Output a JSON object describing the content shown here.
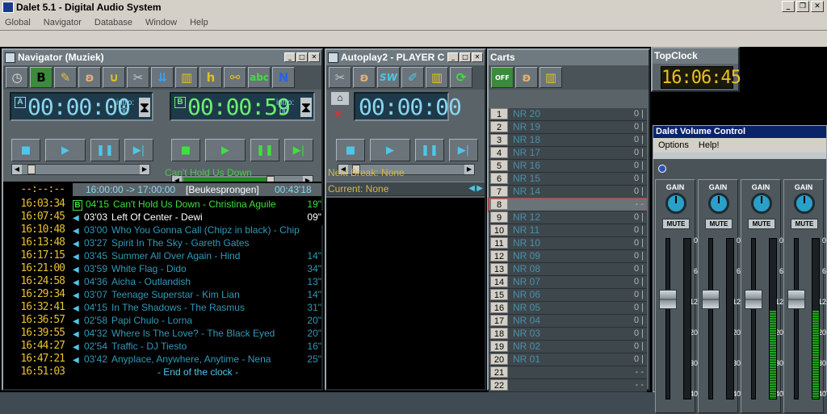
{
  "app": {
    "title": "Dalet 5.1 - Digital Audio System"
  },
  "menu": [
    "Global",
    "Navigator",
    "Database",
    "Window",
    "Help"
  ],
  "navigator": {
    "title": "Navigator (Muziek)",
    "toolbar_letters": {
      "b": "B",
      "h": "h",
      "abc": "abc",
      "n": "N"
    },
    "player_a": {
      "tag": "A",
      "time": "00:00:00",
      "intro_label": "intro:",
      "intro_value": "00"
    },
    "player_b": {
      "tag": "B",
      "time": "00:00:59",
      "intro_label": "intro:",
      "intro_value": "00",
      "progress": 0.75
    },
    "player_a_progress": 0.05,
    "now_playing": "Can't Hold Us Down",
    "clock_header": {
      "range": "16:00:00 -> 17:00:00",
      "name": "[Beukesprongen]",
      "length": "00:43'18"
    },
    "leading_time": "--:--:--",
    "playlist": [
      {
        "time": "16:03:34",
        "dur": "04'15",
        "title": "Can't Hold Us Down - Christina Aguile",
        "intro": "19\"",
        "state": "playing",
        "marker": "B"
      },
      {
        "time": "16:07:45",
        "dur": "03'03",
        "title": "Left Of Center - Dewi",
        "intro": "09\"",
        "state": "next",
        "marker": ""
      },
      {
        "time": "16:10:48",
        "dur": "03'00",
        "title": "Who You Gonna Call (Chipz in black) - Chip",
        "intro": "",
        "state": "",
        "marker": ""
      },
      {
        "time": "16:13:48",
        "dur": "03'27",
        "title": "Spirit In The Sky - Gareth Gates",
        "intro": "",
        "state": "",
        "marker": ""
      },
      {
        "time": "16:17:15",
        "dur": "03'45",
        "title": "Summer All Over Again - Hind",
        "intro": "14\"",
        "state": "",
        "marker": ""
      },
      {
        "time": "16:21:00",
        "dur": "03'59",
        "title": "White Flag - Dido",
        "intro": "34\"",
        "state": "",
        "marker": ""
      },
      {
        "time": "16:24:58",
        "dur": "04'36",
        "title": "Aicha - Outlandish",
        "intro": "13\"",
        "state": "",
        "marker": ""
      },
      {
        "time": "16:29:34",
        "dur": "03'07",
        "title": "Teenage Superstar - Kim Lian",
        "intro": "14\"",
        "state": "",
        "marker": ""
      },
      {
        "time": "16:32:41",
        "dur": "04'15",
        "title": "In The Shadows - The Rasmus",
        "intro": "31\"",
        "state": "",
        "marker": ""
      },
      {
        "time": "16:36:57",
        "dur": "02'58",
        "title": "Papi Chulo - Lorna",
        "intro": "20\"",
        "state": "",
        "marker": ""
      },
      {
        "time": "16:39:55",
        "dur": "04'32",
        "title": "Where Is The Love? - The Black Eyed",
        "intro": "20\"",
        "state": "",
        "marker": ""
      },
      {
        "time": "16:44:27",
        "dur": "02'54",
        "title": "Traffic - DJ Tiesto",
        "intro": "16\"",
        "state": "",
        "marker": ""
      },
      {
        "time": "16:47:21",
        "dur": "03'42",
        "title": "Anyplace, Anywhere, Anytime - Nena",
        "intro": "25\"",
        "state": "",
        "marker": ""
      },
      {
        "time": "16:51:03",
        "dur": "",
        "title": "- End of the clock -",
        "intro": "",
        "state": "end",
        "marker": ""
      }
    ]
  },
  "autoplay": {
    "title": "Autoplay2 - PLAYER C",
    "toolbar_letters": {
      "sw": "SW"
    },
    "time": "00:00:00",
    "progress": 0.04,
    "next_break": "Next Break: None",
    "current": "Current: None"
  },
  "carts": {
    "title": "Carts",
    "toolbar_label": "OFF",
    "items": [
      {
        "num": "1",
        "name": "NR 20",
        "count": "0 |"
      },
      {
        "num": "2",
        "name": "NR 19",
        "count": "0 |"
      },
      {
        "num": "3",
        "name": "NR 18",
        "count": "0 |"
      },
      {
        "num": "4",
        "name": "NR 17",
        "count": "0 |"
      },
      {
        "num": "5",
        "name": "NR 16",
        "count": "0 |"
      },
      {
        "num": "6",
        "name": "NR 15",
        "count": "0 |"
      },
      {
        "num": "7",
        "name": "NR 14",
        "count": "0 |"
      },
      {
        "num": "8",
        "name": "",
        "count": "- -"
      },
      {
        "num": "9",
        "name": "NR 12",
        "count": "0 |"
      },
      {
        "num": "10",
        "name": "NR 11",
        "count": "0 |"
      },
      {
        "num": "11",
        "name": "NR 10",
        "count": "0 |"
      },
      {
        "num": "12",
        "name": "NR 09",
        "count": "0 |"
      },
      {
        "num": "13",
        "name": "NR 08",
        "count": "0 |"
      },
      {
        "num": "14",
        "name": "NR 07",
        "count": "0 |"
      },
      {
        "num": "15",
        "name": "NR 06",
        "count": "0 |"
      },
      {
        "num": "16",
        "name": "NR 05",
        "count": "0 |"
      },
      {
        "num": "17",
        "name": "NR 04",
        "count": "0 |"
      },
      {
        "num": "18",
        "name": "NR 03",
        "count": "0 |"
      },
      {
        "num": "19",
        "name": "NR 02",
        "count": "0 |"
      },
      {
        "num": "20",
        "name": "NR 01",
        "count": "0 |"
      },
      {
        "num": "21",
        "name": "",
        "count": "- -"
      },
      {
        "num": "22",
        "name": "",
        "count": "- -"
      }
    ],
    "selected_index": 7
  },
  "topclock": {
    "title": "TopClock",
    "time": "16:06:45"
  },
  "volume": {
    "title": "Dalet Volume Control",
    "menu": [
      "Options",
      "Help!"
    ],
    "scale": [
      "0",
      "6",
      "12",
      "20",
      "30",
      "40"
    ],
    "channels": [
      {
        "gain": "GAIN",
        "mute": "MUTE",
        "fader": 0.62,
        "meter": 0.0
      },
      {
        "gain": "GAIN",
        "mute": "MUTE",
        "fader": 0.62,
        "meter": 0.0
      },
      {
        "gain": "GAIN",
        "mute": "MUTE",
        "fader": 0.62,
        "meter": 0.55
      },
      {
        "gain": "GAIN",
        "mute": "MUTE",
        "fader": 0.62,
        "meter": 0.55
      }
    ]
  },
  "colors": {
    "accent_green": "#3ee03e",
    "lcd_cyan": "#8ad6f0",
    "clock_yellow": "#e8c030",
    "row_blue": "#2f9ab8"
  }
}
